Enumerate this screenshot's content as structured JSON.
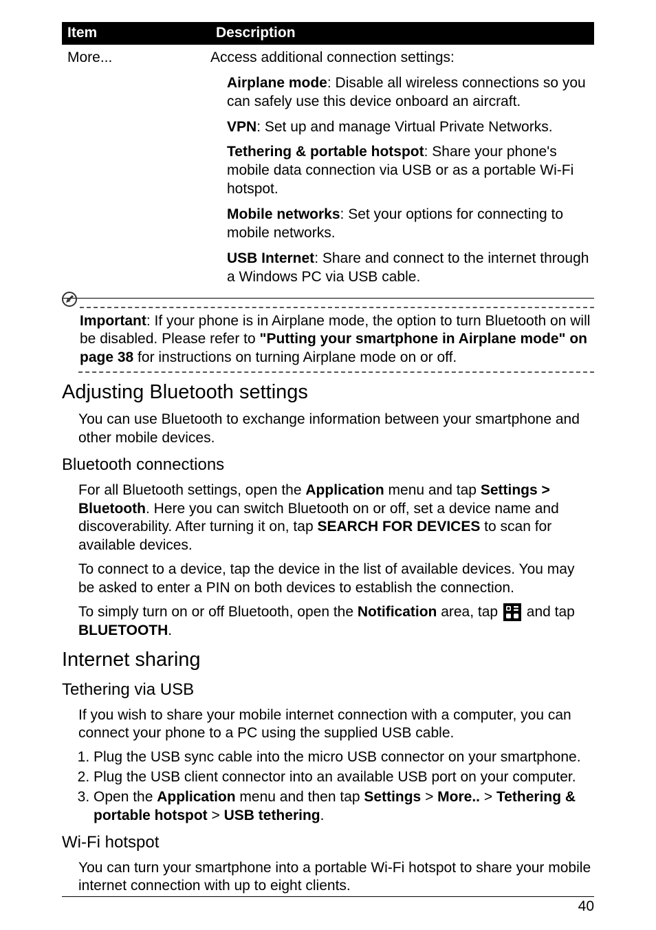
{
  "table": {
    "headers": {
      "item": "Item",
      "description": "Description"
    },
    "row": {
      "item": "More...",
      "intro": "Access additional connection settings:",
      "entries": [
        {
          "label": "Airplane mode",
          "text": ": Disable all wireless connections so you can safely use this device onboard an aircraft."
        },
        {
          "label": "VPN",
          "text": ": Set up and manage Virtual Private Networks."
        },
        {
          "label": "Tethering & portable hotspot",
          "text": ": Share your phone's mobile data connection via USB or as a portable Wi-Fi hotspot."
        },
        {
          "label": "Mobile networks",
          "text": ": Set your options for connecting to mobile networks."
        },
        {
          "label": "USB Internet",
          "text": ": Share and connect to the internet through a Windows PC via USB cable."
        }
      ]
    }
  },
  "note": {
    "label": "Important",
    "a": ": If your phone is in Airplane mode, the option to turn Bluetooth on will be disabled. Please refer to ",
    "ref": "\"Putting your smartphone in Airplane mode\" on page 38",
    "b": " for instructions on turning Airplane mode on or off."
  },
  "bluetooth": {
    "heading": "Adjusting Bluetooth settings",
    "intro": "You can use Bluetooth to exchange information between your smartphone and other mobile devices.",
    "conn_heading": "Bluetooth connections",
    "p1": {
      "a": "For all Bluetooth settings, open the ",
      "b": "Application",
      "c": " menu and tap ",
      "d": "Settings > Bluetooth",
      "e": ". Here you can switch Bluetooth on or off, set a device name and discoverability. After turning it on, tap ",
      "f": "SEARCH FOR DEVICES",
      "g": " to scan for available devices."
    },
    "p2": "To connect to a device, tap the device in the list of available devices. You may be asked to enter a PIN on both devices to establish the connection.",
    "p3": {
      "a": "To simply turn on or off Bluetooth, open the ",
      "b": "Notification",
      "c": " area, tap ",
      "d": " and tap ",
      "e": "BLUETOOTH",
      "f": "."
    }
  },
  "internet": {
    "heading": "Internet sharing",
    "usb_heading": "Tethering via USB",
    "usb_intro": "If you wish to share your mobile internet connection with a computer, you can connect your phone to a PC using the supplied USB cable.",
    "steps": {
      "s1": "Plug the USB sync cable into the micro USB connector on your smartphone.",
      "s2": "Plug the USB client connector into an available USB port on your computer.",
      "s3": {
        "a": "Open the ",
        "b": "Application",
        "c": " menu and then tap ",
        "d": "Settings",
        "e": " > ",
        "f": "More..",
        "g": " > ",
        "h": "Tethering & portable hotspot",
        "i": " > ",
        "j": "USB tethering",
        "k": "."
      }
    },
    "wifi_heading": "Wi-Fi hotspot",
    "wifi_intro": "You can turn your smartphone into a portable Wi-Fi hotspot to share your mobile internet connection with up to eight clients."
  },
  "page_number": "40"
}
